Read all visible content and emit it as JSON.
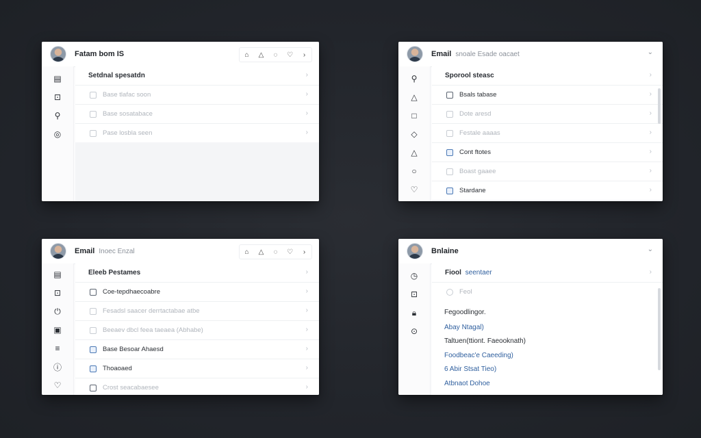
{
  "panel1": {
    "title": "Fatam bom IS",
    "toolbar_icons": [
      "home-icon",
      "bell-icon",
      "chat-icon",
      "pin-icon",
      "chevron-right-icon"
    ],
    "sidebar_icons": [
      "calendar-icon",
      "inbox-icon",
      "pin-icon",
      "info-icon"
    ],
    "rows": [
      {
        "label": "Setdnal spesatdn",
        "type": "header"
      },
      {
        "label": "Base tlafac soon"
      },
      {
        "label": "Base sosatabace"
      },
      {
        "label": "Pase losbla seen"
      }
    ]
  },
  "panel2": {
    "title": "Email",
    "subtitle": "snoale Esade oacaet",
    "sidebar_icons": [
      "search-icon",
      "triangle-icon",
      "square-icon",
      "drop-icon",
      "warning-icon",
      "circle-icon",
      "location-icon"
    ],
    "rows": [
      {
        "label": "Sporool steasc",
        "type": "header"
      },
      {
        "label": "Bsals tabase",
        "style": "dark"
      },
      {
        "label": "Dote aresd"
      },
      {
        "label": "Festale aaaas"
      },
      {
        "label": "Cont ftotes",
        "style": "dark"
      },
      {
        "label": "Boast gaaee"
      },
      {
        "label": "Stardane",
        "style": "dark"
      }
    ]
  },
  "panel3": {
    "title": "Email",
    "subtitle": "Inoec Enzal",
    "toolbar_icons": [
      "home-icon",
      "bell-icon",
      "chat-icon",
      "pin-icon",
      "chevron-right-icon"
    ],
    "sidebar_icons": [
      "calendar-icon",
      "inbox-icon",
      "power-icon",
      "image-icon",
      "menu-icon",
      "info-icon",
      "location-icon"
    ],
    "rows": [
      {
        "label": "Eleeb Pestames",
        "type": "header"
      },
      {
        "label": "Coe-tepdhaecoabre",
        "style": "dark"
      },
      {
        "label": "Fesadsl saacer derrtactabae atbe"
      },
      {
        "label": "Beeaev dbcl feea taeaea (Abhabe)"
      },
      {
        "label": "Base Besoar Ahaesd",
        "style": "dark"
      },
      {
        "label": "Thoaoaed",
        "style": "dark"
      },
      {
        "label": "Crost seacabaesee"
      }
    ]
  },
  "panel4": {
    "title": "Bnlaine",
    "sidebar_icons": [
      "clock-icon",
      "inbox-icon",
      "lock-icon",
      "location-icon"
    ],
    "rows": [
      {
        "label": "Fiool",
        "accent": "seentaer",
        "type": "header"
      },
      {
        "label": "Feol"
      }
    ],
    "doc_lines": [
      {
        "text": "Fegoodlingor.",
        "color": "#2a2e34"
      },
      {
        "text": "Abay Ntagal)",
        "color": "#2f5f9e"
      },
      {
        "text": "Taltuen(ttiont. Faeooknath)",
        "color": "#2a2e34"
      },
      {
        "text": "Foodbeac'e Caeeding)",
        "color": "#2f5f9e"
      },
      {
        "text": "6 Abir Stsat Tieo)",
        "color": "#2f5f9e"
      },
      {
        "text": "Atbnaot Dohoe",
        "color": "#2f5f9e"
      }
    ]
  }
}
